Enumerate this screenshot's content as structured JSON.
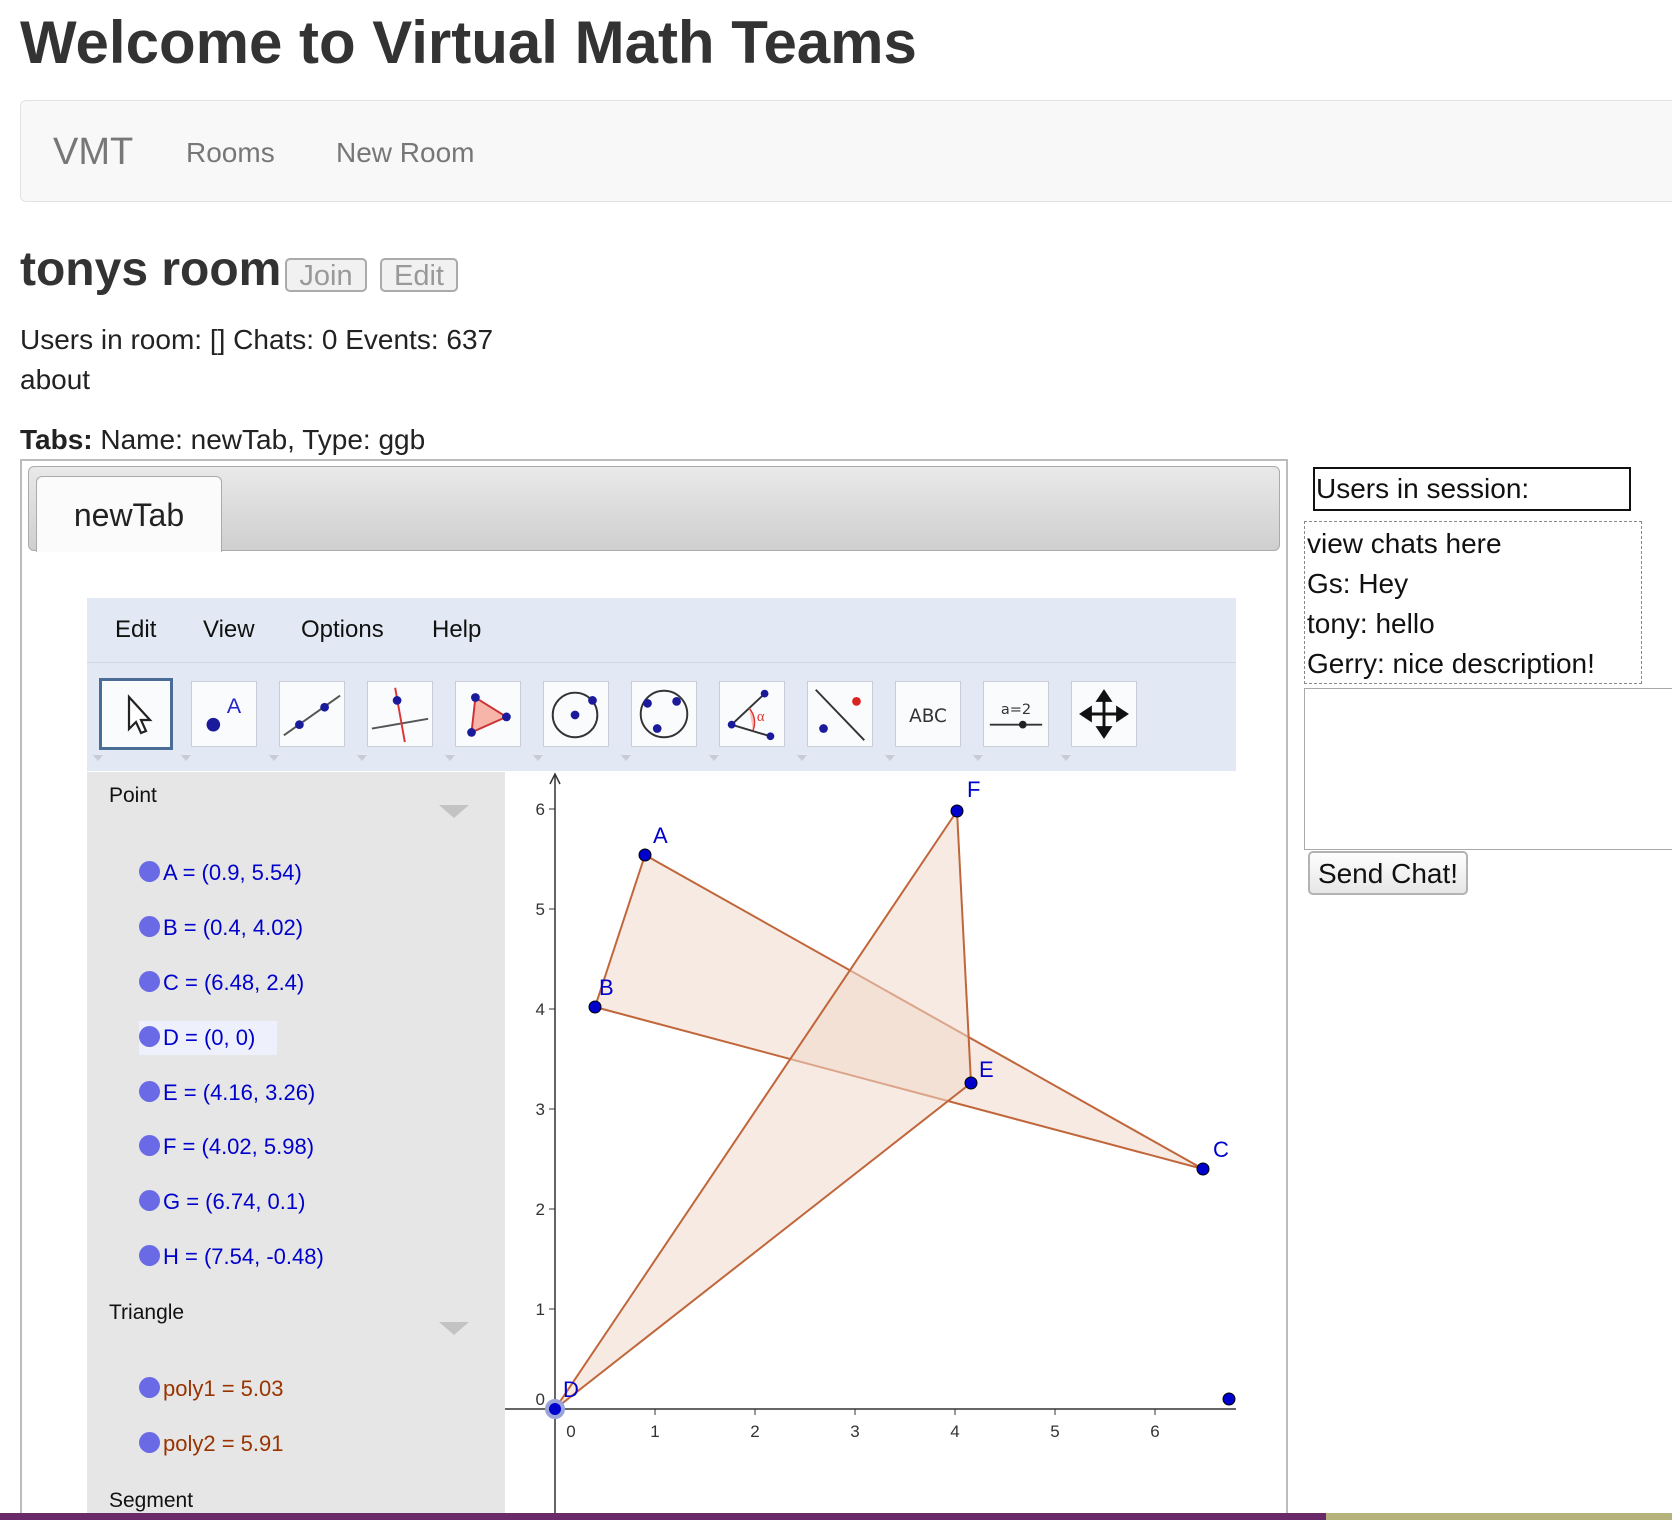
{
  "page": {
    "title": "Welcome to Virtual Math Teams"
  },
  "nav": {
    "brand": "VMT",
    "links": [
      "Rooms",
      "New Room"
    ]
  },
  "room": {
    "name": "tonys room",
    "join_label": "Join",
    "edit_label": "Edit",
    "stats": "Users in room: [] Chats: 0 Events: 637",
    "description": "about",
    "tabs_label": "Tabs:",
    "tabs_value": " Name: newTab, Type: ggb"
  },
  "tabs": [
    {
      "label": "newTab"
    }
  ],
  "ggb": {
    "menu": [
      "Edit",
      "View",
      "Options",
      "Help"
    ],
    "tools": [
      "move-tool",
      "point-tool",
      "line-tool",
      "perpendicular-tool",
      "polygon-tool",
      "circle-center-tool",
      "circle-three-points-tool",
      "angle-tool",
      "reflect-tool",
      "text-tool",
      "slider-tool",
      "move-view-tool"
    ],
    "tool_text": {
      "text": "ABC",
      "slider": "a=2"
    },
    "algebra": {
      "groups": [
        {
          "name": "Point",
          "items": [
            "A = (0.9, 5.54)",
            "B = (0.4, 4.02)",
            "C = (6.48, 2.4)",
            "D = (0, 0)",
            "E = (4.16, 3.26)",
            "F = (4.02, 5.98)",
            "G = (6.74, 0.1)",
            "H = (7.54, -0.48)"
          ]
        },
        {
          "name": "Triangle",
          "items": [
            "poly1 = 5.03",
            "poly2 = 5.91"
          ]
        },
        {
          "name": "Segment",
          "items": []
        }
      ]
    },
    "graph": {
      "x_ticks": [
        "0",
        "1",
        "2",
        "3",
        "4",
        "5",
        "6"
      ],
      "y_ticks": [
        "0",
        "1",
        "2",
        "3",
        "4",
        "5",
        "6"
      ],
      "point_labels": [
        "A",
        "B",
        "C",
        "D",
        "E",
        "F"
      ],
      "colors": {
        "point": "#0000cc",
        "polygon_stroke": "#c0663a",
        "polygon_fill": "#f0d8cc"
      }
    }
  },
  "sidebar": {
    "users_label": "Users in session:",
    "chat_lines": [
      "view chats here",
      "Gs: Hey",
      "tony: hello",
      "Gerry: nice description!"
    ],
    "send_label": "Send Chat!"
  }
}
